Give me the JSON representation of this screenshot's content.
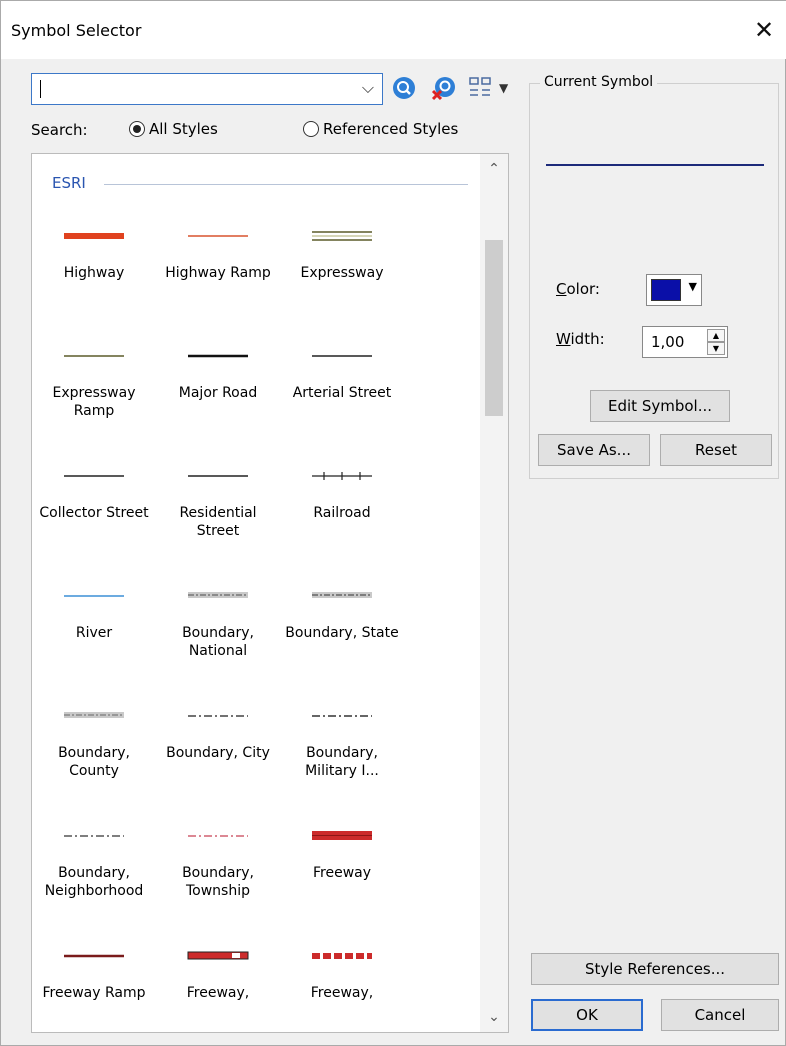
{
  "window": {
    "title": "Symbol Selector"
  },
  "search": {
    "label": "Search:",
    "value": "",
    "scope_all": "All Styles",
    "scope_referenced": "Referenced Styles",
    "selected_scope": "All Styles"
  },
  "symbols": {
    "group": "ESRI",
    "items": [
      {
        "label": "Highway",
        "style": "thick",
        "color": "#e0421f"
      },
      {
        "label": "Highway Ramp",
        "style": "thin",
        "color": "#d9532e"
      },
      {
        "label": "Expressway",
        "style": "triple",
        "color": "#5b5b2a"
      },
      {
        "label": "Expressway Ramp",
        "style": "thin",
        "color": "#5b5b2a"
      },
      {
        "label": "Major Road",
        "style": "medium",
        "color": "#111111"
      },
      {
        "label": "Arterial Street",
        "style": "thin",
        "color": "#222222"
      },
      {
        "label": "Collector Street",
        "style": "thin",
        "color": "#222222"
      },
      {
        "label": "Residential Street",
        "style": "thin",
        "color": "#222222"
      },
      {
        "label": "Railroad",
        "style": "rail",
        "color": "#222222"
      },
      {
        "label": "River",
        "style": "thin",
        "color": "#3b8fd6"
      },
      {
        "label": "Boundary, National",
        "style": "boundary",
        "color": "#777777"
      },
      {
        "label": "Boundary, State",
        "style": "boundary",
        "color": "#666666"
      },
      {
        "label": "Boundary, County",
        "style": "boundary",
        "color": "#888888"
      },
      {
        "label": "Boundary, City",
        "style": "dash",
        "color": "#444444"
      },
      {
        "label": "Boundary, Military I...",
        "style": "dash",
        "color": "#333333"
      },
      {
        "label": "Boundary, Neighborhood",
        "style": "dash",
        "color": "#555555"
      },
      {
        "label": "Boundary, Township",
        "style": "dash",
        "color": "#d06070"
      },
      {
        "label": "Freeway",
        "style": "freeway",
        "color": "#cc2b2b"
      },
      {
        "label": "Freeway Ramp",
        "style": "medium",
        "color": "#7a1b1b"
      },
      {
        "label": "Freeway,",
        "style": "freeway2",
        "color": "#cc2b2b"
      },
      {
        "label": "Freeway,",
        "style": "freeway3",
        "color": "#cc2b2b"
      }
    ]
  },
  "current_symbol": {
    "legend": "Current Symbol",
    "preview_color": "#1c2a7a",
    "color_label": "Color:",
    "color_value": "#0a0fa8",
    "width_label": "Width:",
    "width_value": "1,00"
  },
  "buttons": {
    "edit_symbol": "Edit Symbol...",
    "save_as": "Save As...",
    "reset": "Reset",
    "style_references": "Style References...",
    "ok": "OK",
    "cancel": "Cancel"
  }
}
